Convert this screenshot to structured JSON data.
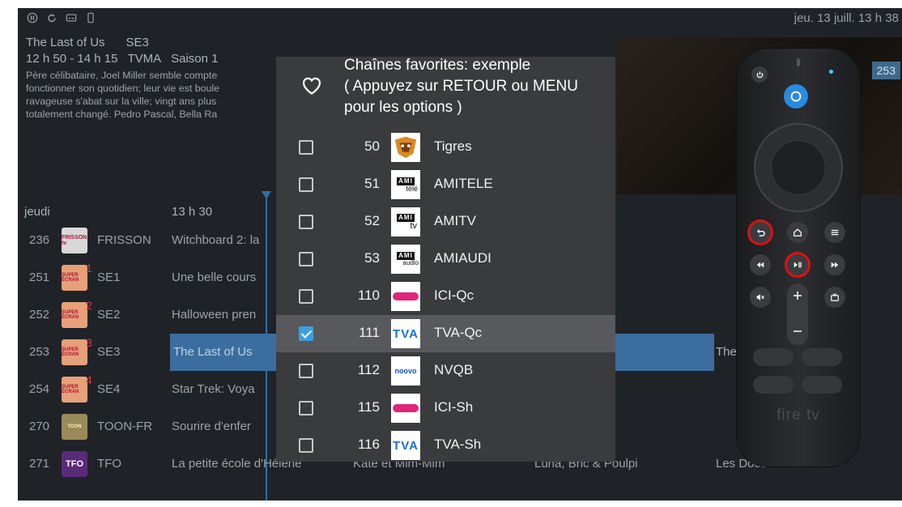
{
  "topbar": {
    "icons": [
      "pause-icon",
      "refresh-icon",
      "subtitles-icon",
      "phone-icon"
    ],
    "datetime": "jeu. 13 juill. 13 h 38"
  },
  "info": {
    "title": "The Last of Us",
    "channel": "SE3",
    "time": "12 h 50 - 14 h 15",
    "rating": "TVMA",
    "season": "Saison 1",
    "description_lines": [
      "Père célibataire, Joel Miller semble compte",
      "fonctionner son quotidien; leur vie est boule",
      "ravageuse s'abat sur la ville; vingt ans plus",
      "totalement changé. Pedro Pascal, Bella Ra"
    ]
  },
  "preview": {
    "channel_badge": "253"
  },
  "guide": {
    "day": "jeudi",
    "time_header": "13 h 30",
    "rows": [
      {
        "num": "236",
        "logo": "frisson-tv-logo",
        "name": "FRISSON",
        "programs": [
          {
            "title": "Witchboard 2: la"
          }
        ]
      },
      {
        "num": "251",
        "logo": "super-ecran-logo",
        "badge": "1",
        "name": "SE1",
        "programs": [
          {
            "title": "Une belle cours"
          }
        ]
      },
      {
        "num": "252",
        "logo": "super-ecran-logo",
        "badge": "2",
        "name": "SE2",
        "programs": [
          {
            "title": "Halloween pren"
          }
        ]
      },
      {
        "num": "253",
        "logo": "super-ecran-logo",
        "badge": "3",
        "name": "SE3",
        "programs": [
          {
            "title": "The Last of Us"
          },
          {
            "title": "The"
          }
        ],
        "highlighted": true
      },
      {
        "num": "254",
        "logo": "super-ecran-logo",
        "badge": "4",
        "name": "SE4",
        "programs": [
          {
            "title": "Star Trek: Voya"
          }
        ]
      },
      {
        "num": "270",
        "logo": "toon-fr-logo",
        "name": "TOON-FR",
        "programs": [
          {
            "title": "Sourire d'enfer"
          }
        ]
      },
      {
        "num": "271",
        "logo": "tfo-logo",
        "name": "TFO",
        "programs": [
          {
            "title": "La petite école d'Hélène"
          },
          {
            "title": "Kate et Mim-Mim"
          },
          {
            "title": "Luna, Bric & Poulpi"
          },
          {
            "title": "Les Doozers"
          }
        ]
      }
    ]
  },
  "dialog": {
    "title_lines": [
      "Chaînes favorites: exemple",
      "( Appuyez sur RETOUR ou MENU",
      "pour les options )"
    ],
    "channels": [
      {
        "num": "50",
        "name": "Tigres",
        "logo": "tigres-logo",
        "checked": false
      },
      {
        "num": "51",
        "name": "AMITELE",
        "logo": "ami-tele-logo",
        "logo_text": "AMI",
        "logo_sub": "télé",
        "checked": false
      },
      {
        "num": "52",
        "name": "AMITV",
        "logo": "ami-tv-logo",
        "logo_text": "AMI",
        "logo_sub": "tv",
        "checked": false
      },
      {
        "num": "53",
        "name": "AMIAUDI",
        "logo": "ami-audio-logo",
        "logo_text": "AMI",
        "logo_sub": "audio",
        "checked": false
      },
      {
        "num": "110",
        "name": "ICI-Qc",
        "logo": "ici-tele-logo",
        "checked": false
      },
      {
        "num": "111",
        "name": "TVA-Qc",
        "logo": "tva-logo",
        "logo_text": "TVA",
        "checked": true,
        "selected": true
      },
      {
        "num": "112",
        "name": "NVQB",
        "logo": "noovo-logo",
        "logo_text": "noovo",
        "checked": false
      },
      {
        "num": "115",
        "name": "ICI-Sh",
        "logo": "ici-tele-logo",
        "checked": false
      },
      {
        "num": "116",
        "name": "TVA-Sh",
        "logo": "tva-logo",
        "logo_text": "TVA",
        "checked": false
      }
    ]
  },
  "remote": {
    "brand": "fire tv",
    "highlighted_buttons": [
      "back-button",
      "play-pause-button"
    ]
  },
  "colors": {
    "background": "#1f2328",
    "dialog": "#3a3b3d",
    "selection": "#57595c",
    "checkbox_checked": "#3aa0e0",
    "program_highlight": "#3b6e9e",
    "remote_highlight": "#e01010"
  }
}
